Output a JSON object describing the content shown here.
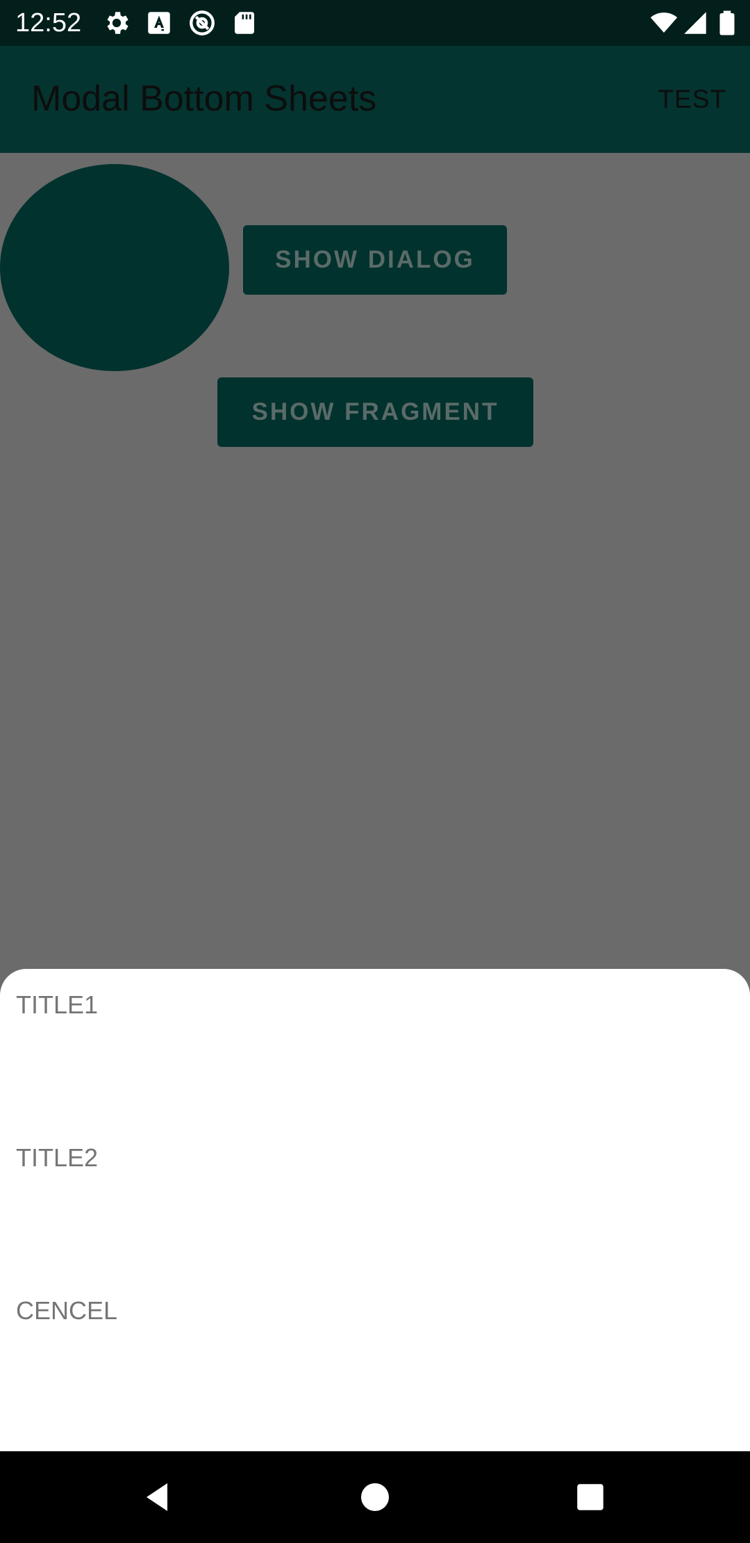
{
  "status_bar": {
    "time": "12:52",
    "left_icons": [
      "gear-icon",
      "text-a-icon",
      "at-sign-icon",
      "sd-card-icon"
    ],
    "right_icons": [
      "wifi-icon",
      "signal-icon",
      "battery-icon"
    ]
  },
  "app_bar": {
    "title": "Modal Bottom Sheets",
    "action_label": "TEST"
  },
  "main": {
    "show_dialog_label": "SHOW DIALOG",
    "show_fragment_label": "SHOW FRAGMENT"
  },
  "bottom_sheet": {
    "items": [
      {
        "label": "TITLE1"
      },
      {
        "label": "TITLE2"
      },
      {
        "label": "CENCEL"
      }
    ]
  },
  "nav_bar": {
    "icons": [
      "back-icon",
      "home-icon",
      "recents-icon"
    ]
  },
  "colors": {
    "status_bar": "#021f1c",
    "app_bar": "#04342f",
    "scrim_background": "#6b6b6b",
    "button": "#02322d",
    "sheet": "#ffffff",
    "sheet_text": "#757575"
  }
}
